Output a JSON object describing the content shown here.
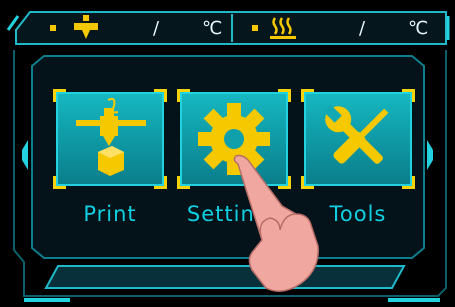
{
  "status_bar": {
    "nozzle": {
      "icon": "nozzle-icon",
      "current": "",
      "separator": "/",
      "target": "",
      "unit": "℃"
    },
    "bed": {
      "icon": "heated-bed-icon",
      "current": "",
      "separator": "/",
      "target": "",
      "unit": "℃"
    }
  },
  "menu": {
    "items": [
      {
        "label": "Print",
        "icon": "print-icon"
      },
      {
        "label": "Settings",
        "icon": "gear-icon"
      },
      {
        "label": "Tools",
        "icon": "tools-icon"
      }
    ]
  },
  "colors": {
    "accent": "#23d2df",
    "icon": "#f5c800",
    "tile": "#12a8b4",
    "label": "#0fd0e0",
    "background": "#000000"
  }
}
